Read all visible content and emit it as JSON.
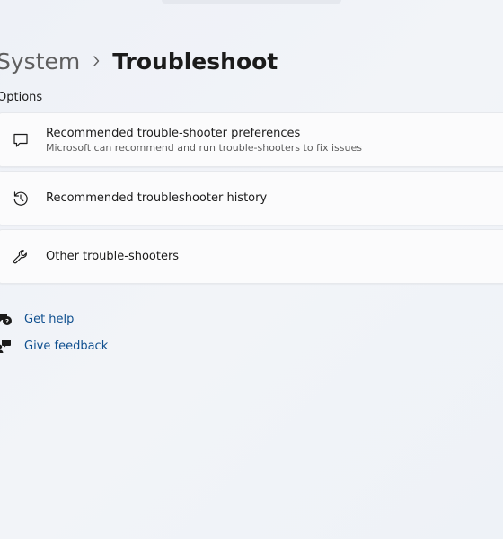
{
  "breadcrumb": {
    "parent": "System",
    "current": "Troubleshoot"
  },
  "section": {
    "title": "Options"
  },
  "options": [
    {
      "icon": "chat-bubble-icon",
      "title": "Recommended trouble-shooter preferences",
      "description": "Microsoft can recommend and run trouble-shooters to fix issues"
    },
    {
      "icon": "history-icon",
      "title": "Recommended troubleshooter history"
    },
    {
      "icon": "wrench-icon",
      "title": "Other trouble-shooters"
    }
  ],
  "links": {
    "get_help": "Get help",
    "give_feedback": "Give feedback"
  },
  "colors": {
    "link": "#0f4f8f",
    "card_background": "#fbfbfc",
    "page_background": "#f0f3f8"
  }
}
